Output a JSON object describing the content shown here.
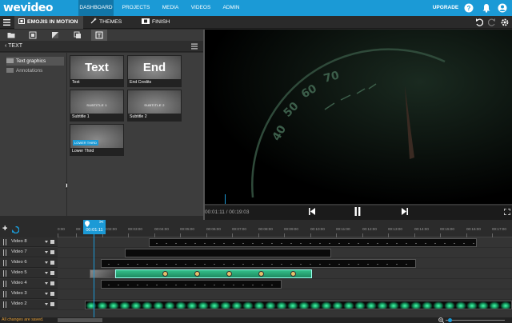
{
  "app": {
    "logo": "wevideo"
  },
  "nav": {
    "items": [
      "DASHBOARD",
      "PROJECTS",
      "MEDIA",
      "VIDEOS",
      "ADMIN"
    ],
    "upgrade": "UPGRADE",
    "active": "DASHBOARD"
  },
  "toolbar": {
    "tabs": [
      {
        "label": "EMOJIS IN MOTION",
        "icon": "film-icon"
      },
      {
        "label": "THEMES",
        "icon": "magic-wand-icon"
      },
      {
        "label": "FINISH",
        "icon": "film-strip-icon"
      }
    ]
  },
  "panel": {
    "back_label": "TEXT",
    "folders": [
      {
        "label": "Text graphics",
        "selected": true
      },
      {
        "label": "Annotations",
        "selected": false
      }
    ],
    "tiles": [
      {
        "caption": "Text",
        "big": "Text"
      },
      {
        "caption": "End Credits",
        "big": "End"
      },
      {
        "caption": "Subtitle 1",
        "small": "SUBTITLE 1"
      },
      {
        "caption": "Subtitle 2",
        "small": "SUBTITLE 2"
      },
      {
        "caption": "Lower Third",
        "badge": "LOWER THIRD"
      }
    ]
  },
  "player": {
    "timecode": "00:01:11 / 00:19:03"
  },
  "timeline": {
    "playhead_time": "00:01:11",
    "ticks": [
      "0:00",
      "00:",
      "00:02:00",
      "00:03:00",
      "00:04:00",
      "00:05:00",
      "00:06:00",
      "00:07:00",
      "00:08:00",
      "00:09:00",
      "00:10:00",
      "00:11:00",
      "00:12:00",
      "00:13:00",
      "00:14:00",
      "00:15:00",
      "00:16:00",
      "00:17:00"
    ],
    "tracks": [
      "Video 8",
      "Video 7",
      "Video 6",
      "Video 5",
      "Video 4",
      "Video 3",
      "Video 2"
    ]
  },
  "status": {
    "saved_text": "All changes are saved."
  },
  "colors": {
    "brand": "#1b9ad6",
    "status": "#e8a23a",
    "clip_green": "#34c08a"
  }
}
